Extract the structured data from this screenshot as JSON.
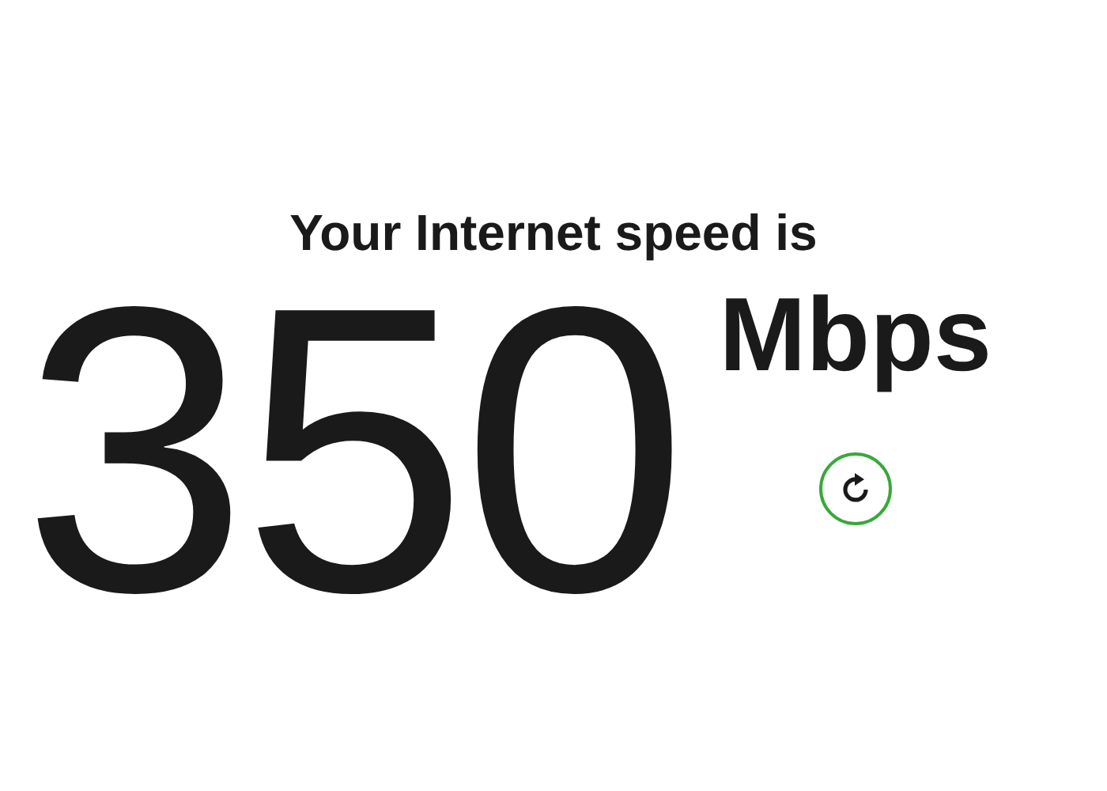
{
  "heading": "Your Internet speed is",
  "result": {
    "speed": "350",
    "unit": "Mbps"
  }
}
